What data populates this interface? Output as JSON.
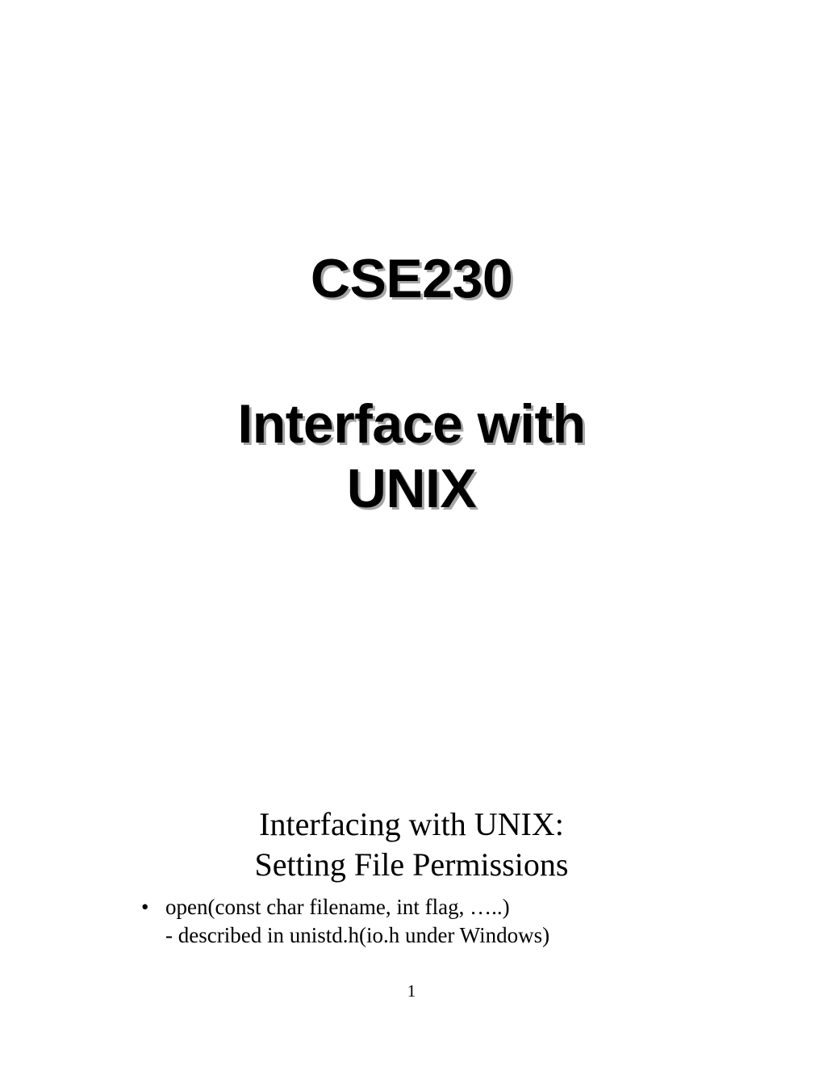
{
  "title": {
    "main": "CSE230",
    "line1": "Interface with",
    "line2": "UNIX"
  },
  "section": {
    "heading1": "Interfacing with UNIX:",
    "heading2": "Setting File Permissions",
    "bullets": [
      {
        "text": "open(const char filename, int flag, …..)",
        "subtext": "- described in unistd.h(io.h under Windows)"
      }
    ]
  },
  "page_number": "1"
}
